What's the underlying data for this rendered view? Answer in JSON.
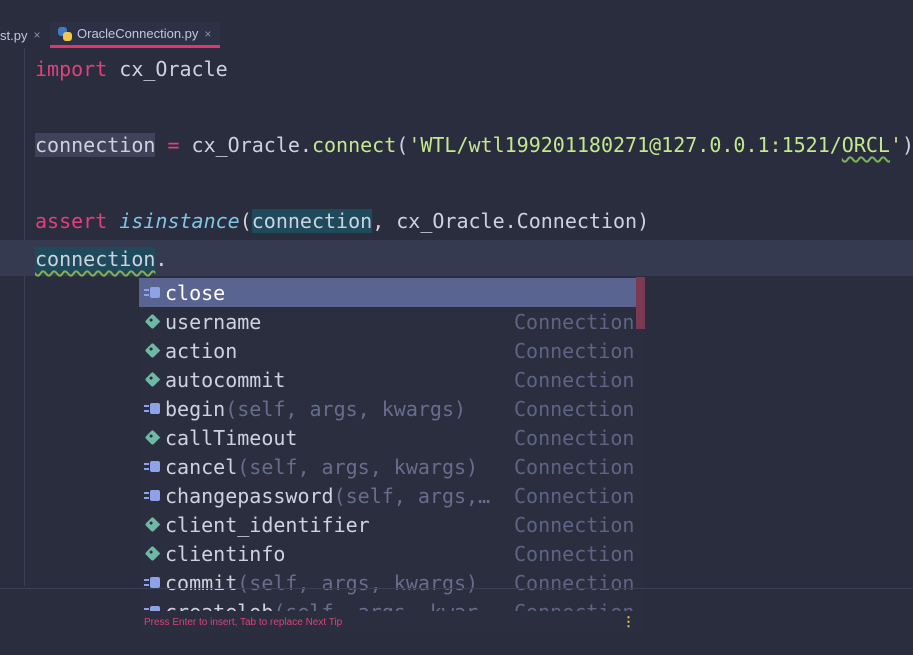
{
  "tabs": [
    {
      "label": "st.py",
      "close": "×"
    },
    {
      "label": "OracleConnection.py",
      "close": "×"
    }
  ],
  "code": {
    "line1": {
      "kw": "import",
      "rest": " cx_Oracle"
    },
    "line2": {
      "var": "connection",
      "eq": " = ",
      "mod": "cx_Oracle.",
      "fn": "connect",
      "open": "(",
      "str1": "'WTL/wtl199201180271@127.0.0.1:1521/",
      "str2": "ORCL",
      "str3": "'",
      "close": ")"
    },
    "line3": {
      "kw": "assert",
      "space": " ",
      "builtin": "isinstance",
      "open": "(",
      "arg": "connection",
      "rest": ", cx_Oracle.Connection)"
    },
    "line4": {
      "var": "connection",
      "dot": "."
    }
  },
  "completion": {
    "items": [
      {
        "icon": "method",
        "name": "close",
        "sig": "",
        "type": ""
      },
      {
        "icon": "field",
        "name": "username",
        "sig": "",
        "type": "Connection"
      },
      {
        "icon": "field",
        "name": "action",
        "sig": "",
        "type": "Connection"
      },
      {
        "icon": "field",
        "name": "autocommit",
        "sig": "",
        "type": "Connection"
      },
      {
        "icon": "method",
        "name": "begin",
        "sig": "(self, args, kwargs)",
        "type": "Connection"
      },
      {
        "icon": "field",
        "name": "callTimeout",
        "sig": "",
        "type": "Connection"
      },
      {
        "icon": "method",
        "name": "cancel",
        "sig": "(self, args, kwargs)",
        "type": "Connection"
      },
      {
        "icon": "method",
        "name": "changepassword",
        "sig": "(self, args,…",
        "type": "Connection"
      },
      {
        "icon": "field",
        "name": "client_identifier",
        "sig": "",
        "type": "Connection"
      },
      {
        "icon": "field",
        "name": "clientinfo",
        "sig": "",
        "type": "Connection"
      },
      {
        "icon": "method",
        "name": "commit",
        "sig": "(self, args, kwargs)",
        "type": "Connection"
      },
      {
        "icon": "method",
        "name": "createlob",
        "sig": "(self, args, kwar",
        "type": "Connection"
      }
    ],
    "footer_hint": "Press Enter to insert, Tab to replace  Next Tip",
    "footer_menu": "⋮"
  }
}
